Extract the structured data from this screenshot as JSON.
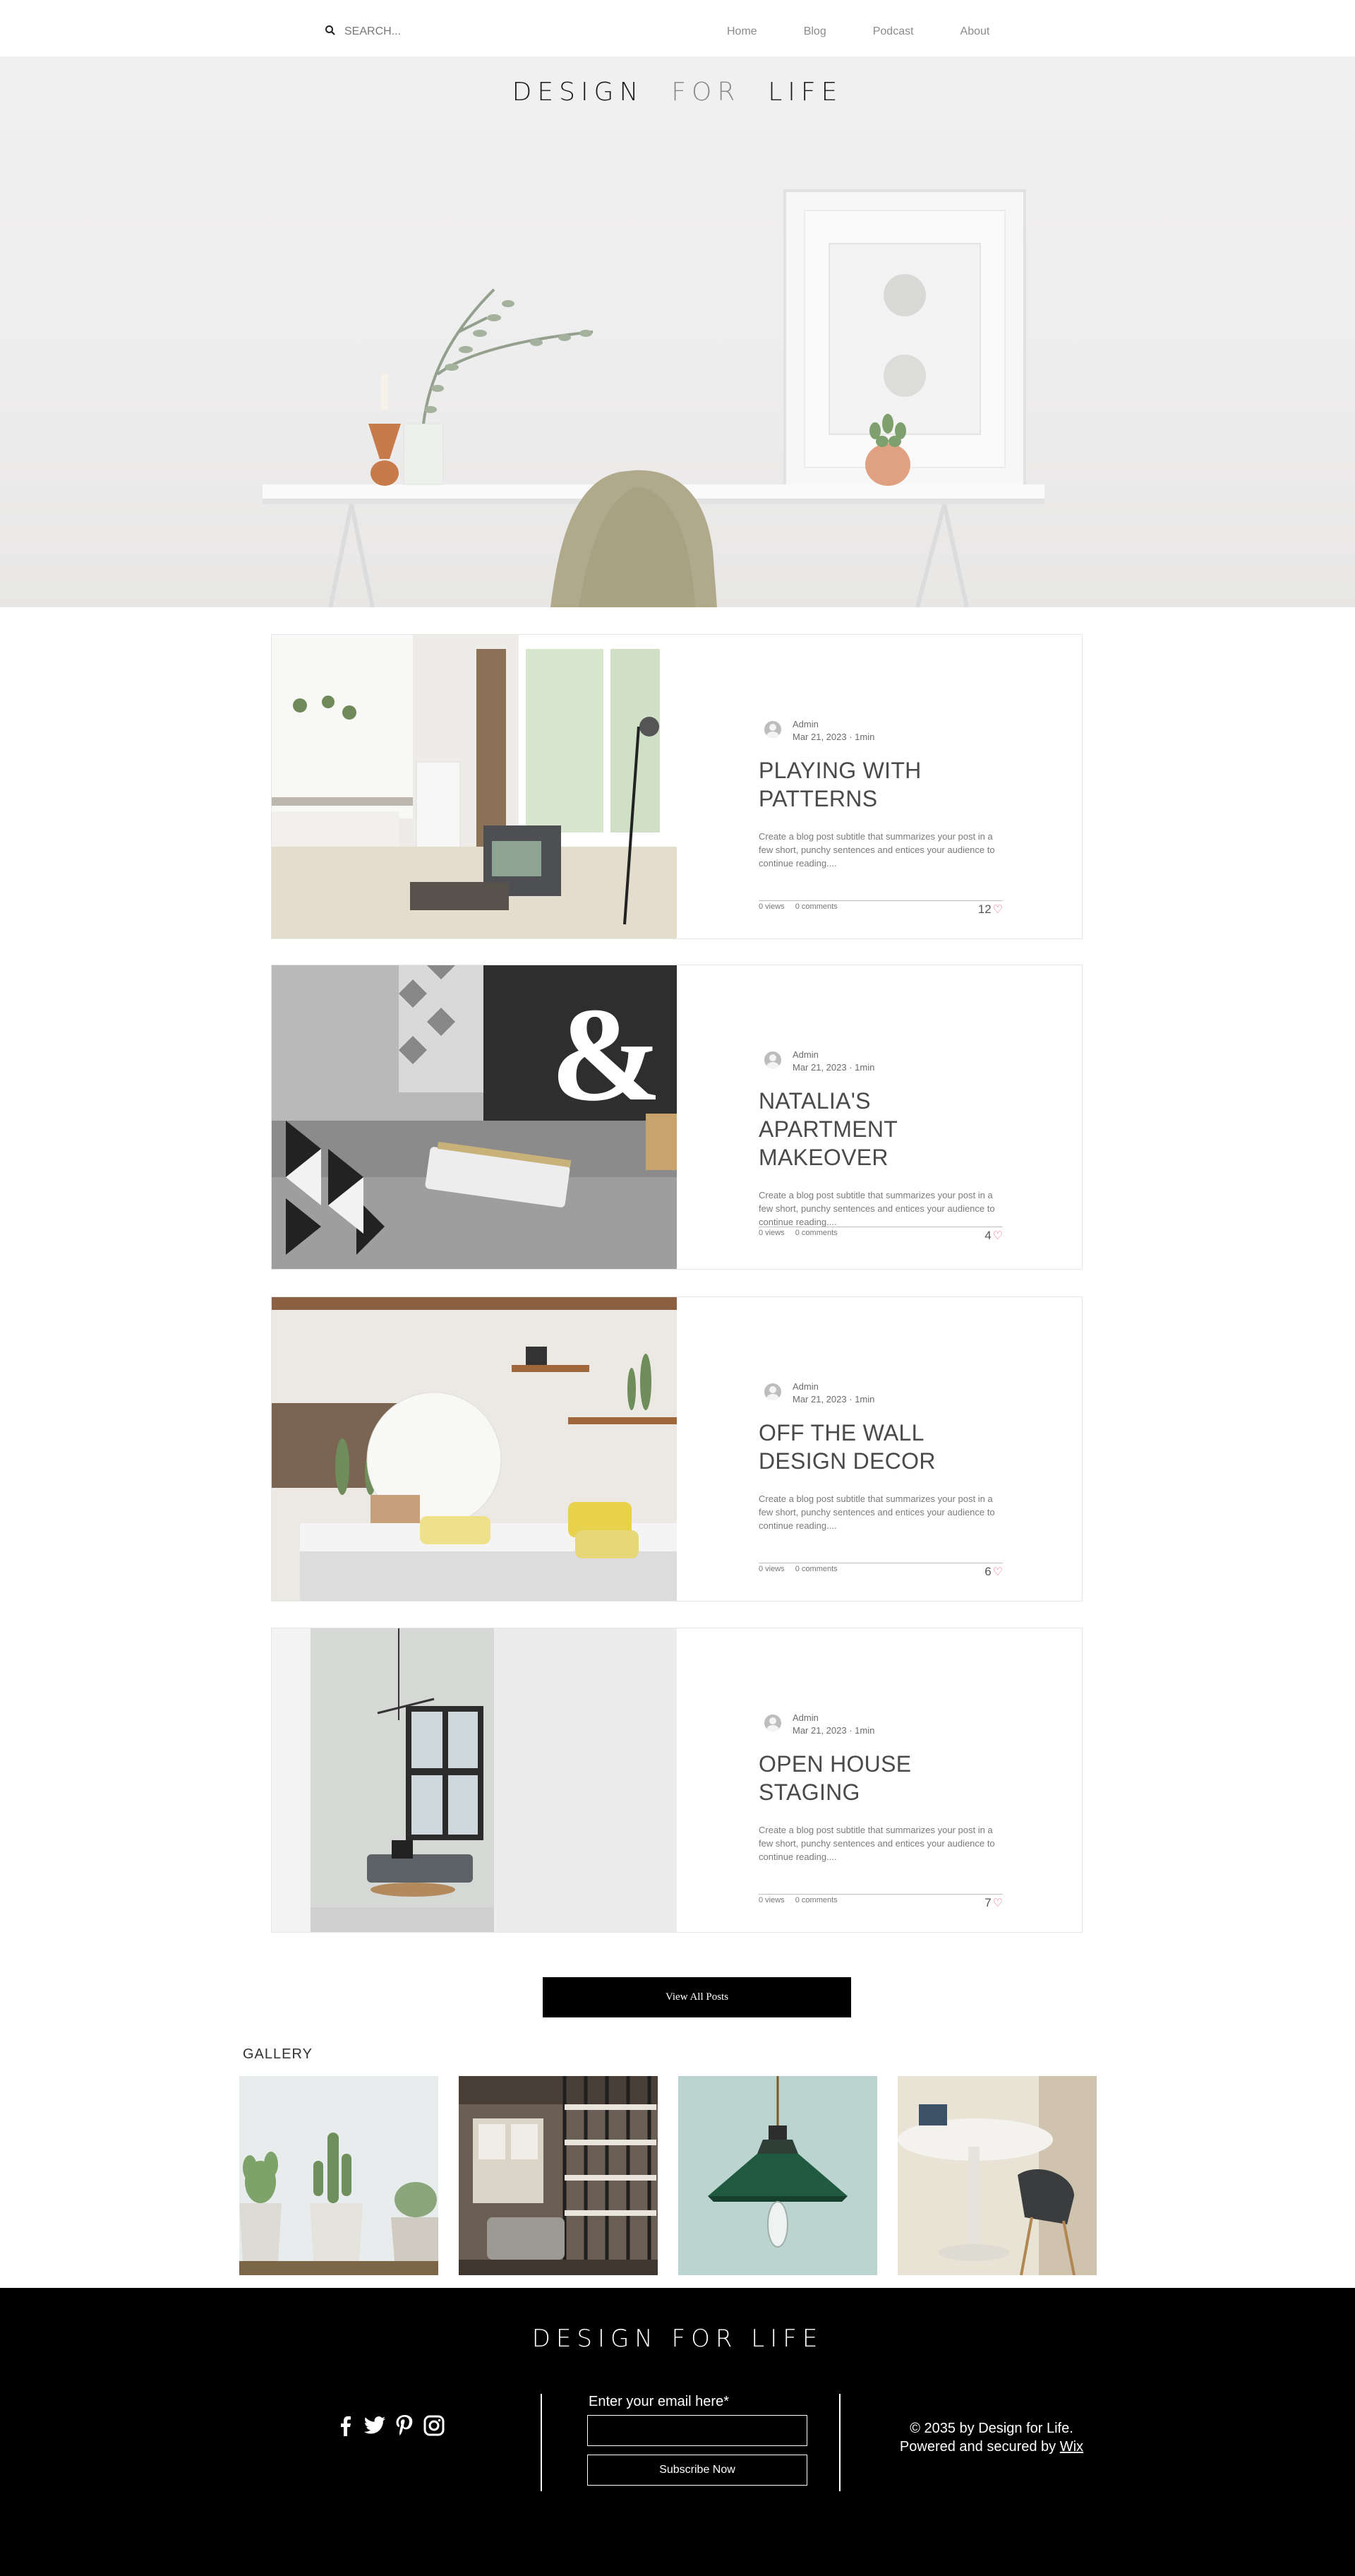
{
  "header": {
    "search_placeholder": "SEARCH...",
    "nav": [
      "Home",
      "Blog",
      "Podcast",
      "About"
    ]
  },
  "hero": {
    "title_part1": "DESIGN",
    "title_part2": "FOR",
    "title_part3": "LIFE"
  },
  "posts": [
    {
      "author": "Admin",
      "date": "Mar 21, 2023",
      "read_time": "1min",
      "title": "PLAYING WITH PATTERNS",
      "excerpt": "Create a blog post subtitle that summarizes your post in a few short, punchy sentences and entices your audience to continue reading....",
      "views": "0 views",
      "comments": "0 comments",
      "likes": "12"
    },
    {
      "author": "Admin",
      "date": "Mar 21, 2023",
      "read_time": "1min",
      "title": "NATALIA'S APARTMENT MAKEOVER",
      "excerpt": "Create a blog post subtitle that summarizes your post in a few short, punchy sentences and entices your audience to continue reading....",
      "views": "0 views",
      "comments": "0 comments",
      "likes": "4"
    },
    {
      "author": "Admin",
      "date": "Mar 21, 2023",
      "read_time": "1min",
      "title": "OFF THE WALL DESIGN DECOR",
      "excerpt": "Create a blog post subtitle that summarizes your post in a few short, punchy sentences and entices your audience to continue reading....",
      "views": "0 views",
      "comments": "0 comments",
      "likes": "6"
    },
    {
      "author": "Admin",
      "date": "Mar 21, 2023",
      "read_time": "1min",
      "title": "OPEN HOUSE STAGING",
      "excerpt": "Create a blog post subtitle that summarizes your post in a few short, punchy sentences and entices your audience to continue reading....",
      "views": "0 views",
      "comments": "0 comments",
      "likes": "7"
    }
  ],
  "view_all_label": "View All Posts",
  "gallery": {
    "title": "GALLERY"
  },
  "footer": {
    "title": "DESIGN  FOR  LIFE",
    "email_label": "Enter your email here*",
    "subscribe_label": "Subscribe Now",
    "copyright_line1": "© 2035 by Design for Life.",
    "copyright_line2": "Powered and secured by",
    "wix_link": "Wix",
    "social": [
      "facebook-icon",
      "twitter-icon",
      "pinterest-icon",
      "instagram-icon"
    ]
  },
  "colors": {
    "accent_heart": "#e55a7a",
    "footer_bg": "#000000"
  }
}
